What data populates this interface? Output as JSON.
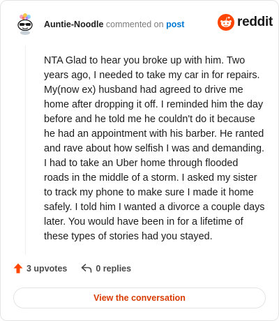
{
  "header": {
    "username": "Auntie-Noodle",
    "action_text": "commented on",
    "post_link": "post",
    "avatar_icon": "snoo-avatar-icon"
  },
  "brand": {
    "icon": "reddit-logo-icon",
    "wordmark": "reddit",
    "color": "#ff4500"
  },
  "comment": {
    "body": "NTA Glad to hear you broke up with him. Two\nyears ago, I needed to take my car in for repairs.\nMy(now ex) husband had agreed to drive me\nhome after dropping it off. I reminded him the day\nbefore and he told me he couldn't do it because\nhe had an appointment with his barber. He ranted\nand rave about how selfish I was and demanding.\nI had to take an Uber home through flooded\nroads in the middle of a storm. I asked my sister\nto track my phone to make sure I made it home\nsafely. I told him I wanted a divorce a couple days\nlater. You would have been in for a lifetime of\nthese types of stories had you stayed."
  },
  "actions": {
    "upvotes_label": "3 upvotes",
    "upvote_icon": "upvote-arrow-icon",
    "replies_label": "0 replies",
    "reply_icon": "reply-arrow-icon"
  },
  "cta": {
    "label": "View the conversation",
    "color": "#d93a00"
  }
}
